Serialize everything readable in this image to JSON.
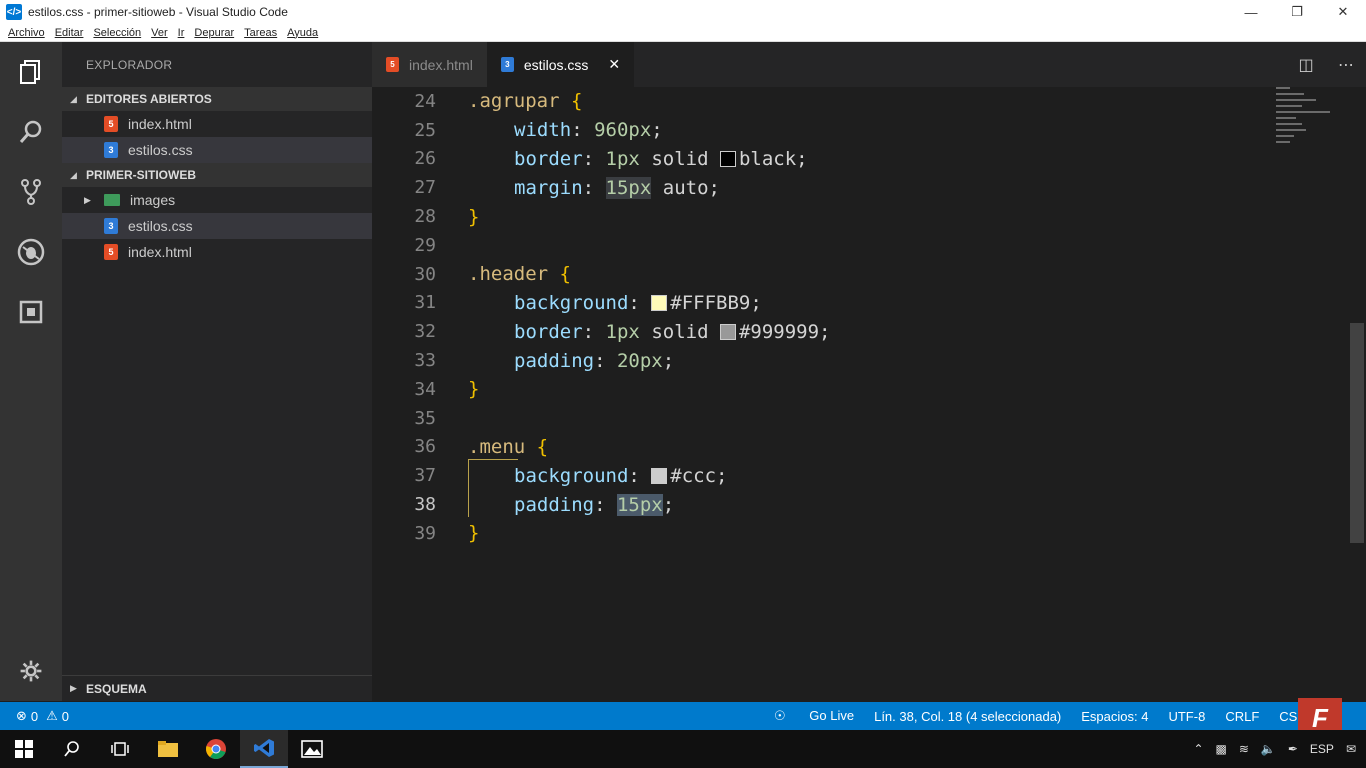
{
  "window": {
    "title": "estilos.css - primer-sitioweb - Visual Studio Code"
  },
  "menu": [
    "Archivo",
    "Editar",
    "Selección",
    "Ver",
    "Ir",
    "Depurar",
    "Tareas",
    "Ayuda"
  ],
  "sidebar": {
    "title": "EXPLORADOR",
    "open_editors": {
      "label": "EDITORES ABIERTOS",
      "items": [
        "index.html",
        "estilos.css"
      ]
    },
    "project": {
      "label": "PRIMER-SITIOWEB",
      "items": [
        "images",
        "estilos.css",
        "index.html"
      ]
    },
    "outline_label": "ESQUEMA"
  },
  "tabs": [
    {
      "label": "index.html",
      "type": "html"
    },
    {
      "label": "estilos.css",
      "type": "css"
    }
  ],
  "editor": {
    "cursor_line": 38,
    "lines": [
      {
        "n": "24",
        "text": ".agrupar {"
      },
      {
        "n": "25",
        "text": "width: 960px;"
      },
      {
        "n": "26",
        "text": "border: 1px solid black;"
      },
      {
        "n": "27",
        "text": "margin: 15px auto;"
      },
      {
        "n": "28",
        "text": "}"
      },
      {
        "n": "29",
        "text": ""
      },
      {
        "n": "30",
        "text": ".header {"
      },
      {
        "n": "31",
        "text": "background: #FFFBB9;"
      },
      {
        "n": "32",
        "text": "border: 1px solid #999999;"
      },
      {
        "n": "33",
        "text": "padding: 20px;"
      },
      {
        "n": "34",
        "text": "}"
      },
      {
        "n": "35",
        "text": ""
      },
      {
        "n": "36",
        "text": ".menu {"
      },
      {
        "n": "37",
        "text": "background: #ccc;"
      },
      {
        "n": "38",
        "text": "padding: 15px;"
      },
      {
        "n": "39",
        "text": "}"
      }
    ],
    "tokens": {
      "l24_sel": ".agrupar",
      "l24_brace": "{",
      "l25_prop": "width",
      "l25_val": "960px",
      "l26_prop": "border",
      "l26_num": "1px",
      "l26_kw": "solid",
      "l26_col": "black",
      "l27_prop": "margin",
      "l27_num": "15px",
      "l27_kw": "auto",
      "l28_brace": "}",
      "l30_sel": ".header",
      "l30_brace": "{",
      "l31_prop": "background",
      "l31_col": "#FFFBB9",
      "l32_prop": "border",
      "l32_num": "1px",
      "l32_kw": "solid",
      "l32_col": "#999999",
      "l33_prop": "padding",
      "l33_num": "20px",
      "l34_brace": "}",
      "l36_sel": ".menu",
      "l36_brace": "{",
      "l37_prop": "background",
      "l37_col": "#ccc",
      "l38_prop": "padding",
      "l38_num": "15px",
      "l39_brace": "}"
    },
    "swatch_colors": {
      "black": "#000000",
      "header_bg": "#FFFBB9",
      "header_border": "#999999",
      "menu_bg": "#cccccc"
    }
  },
  "statusbar": {
    "errors": "0",
    "warnings": "0",
    "go_live": "Go Live",
    "position": "Lín. 38, Col. 18 (4 seleccionada)",
    "spaces": "Espacios: 4",
    "encoding": "UTF-8",
    "eol": "CRLF",
    "language": "CSS",
    "brand": "F"
  },
  "colors": {
    "statusbar": "#007acc",
    "activitybar": "#333333",
    "sidebar": "#252526",
    "editor": "#1e1e1e"
  }
}
